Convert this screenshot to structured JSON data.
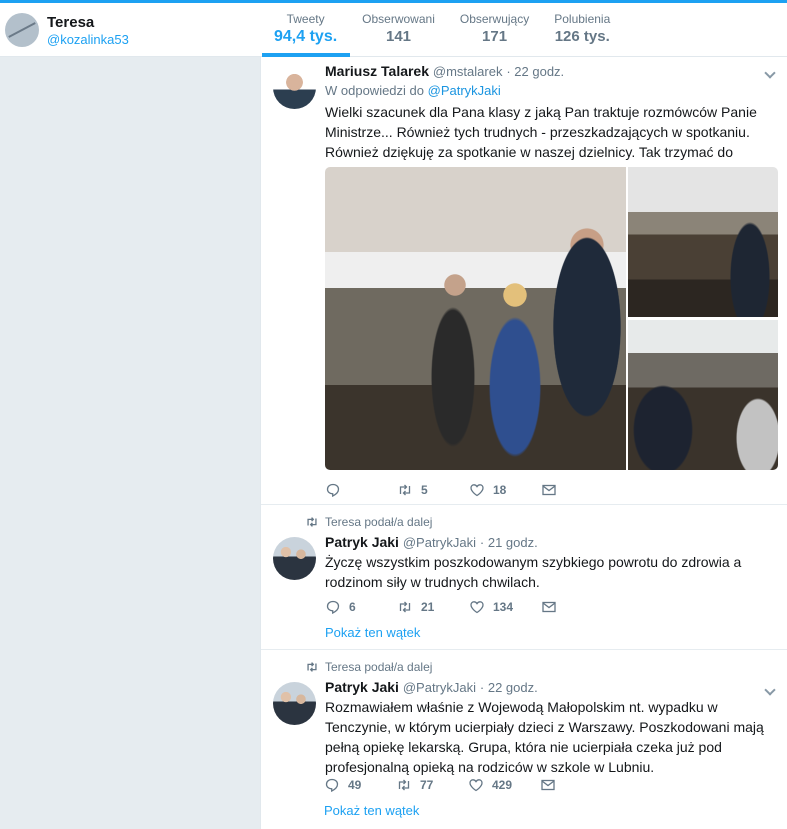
{
  "profile": {
    "name": "Teresa",
    "handle": "@kozalinka53"
  },
  "stats": [
    {
      "label": "Tweety",
      "value": "94,4 tys.",
      "active": true
    },
    {
      "label": "Obserwowani",
      "value": "141"
    },
    {
      "label": "Obserwujący",
      "value": "171"
    },
    {
      "label": "Polubienia",
      "value": "126 tys."
    }
  ],
  "tweets": [
    {
      "name": "Mariusz Talarek",
      "handle": "@mstalarek",
      "time": "· 22 godz.",
      "reply_prefix": "W odpowiedzi do",
      "reply_to": "@PatrykJaki",
      "text": "Wielki szacunek dla Pana klasy z jaką Pan traktuje rozmówców Panie Ministrze... Również tych trudnych - przeszkadzających w spotkaniu. Również dziękuję za spotkanie w naszej dzielnicy. Tak trzymać do przodu... :-)",
      "replies": "",
      "retweets": "5",
      "likes": "18"
    },
    {
      "retweeted_by": "Teresa podał/a dalej",
      "name": "Patryk Jaki",
      "handle": "@PatrykJaki",
      "time": "· 21 godz.",
      "text": "Życzę wszystkim poszkodowanym szybkiego powrotu do zdrowia a rodzinom siły w trudnych chwilach.",
      "replies": "6",
      "retweets": "21",
      "likes": "134",
      "thread_link": "Pokaż ten wątek"
    },
    {
      "retweeted_by": "Teresa podał/a dalej",
      "name": "Patryk Jaki",
      "handle": "@PatrykJaki",
      "time": "· 22 godz.",
      "text": "Rozmawiałem właśnie z Wojewodą Małopolskim nt. wypadku w Tenczynie, w którym ucierpiały dzieci z Warszawy. Poszkodowani mają pełną opiekę lekarską. Grupa, która nie ucierpiała czeka już pod profesjonalną opieką na rodziców w szkole w Lubniu.",
      "replies": "49",
      "retweets": "77",
      "likes": "429",
      "thread_link": "Pokaż ten wątek"
    }
  ],
  "colors": {
    "accent": "#1da1f2",
    "muted": "#657786",
    "background": "#e6ecf0"
  }
}
